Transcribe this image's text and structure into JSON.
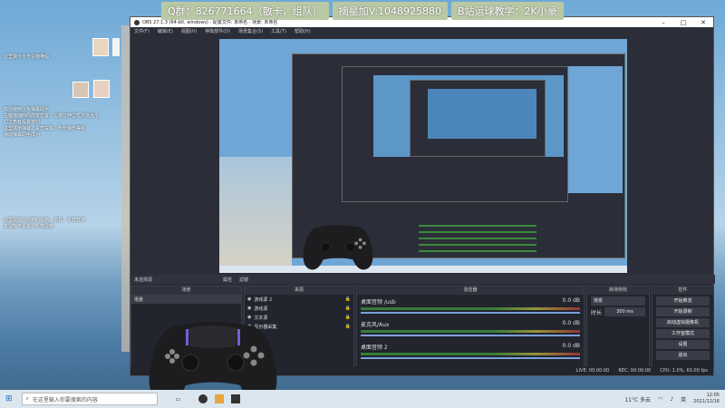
{
  "banner": {
    "qq": "Q群：826771664（散卡，组队）",
    "wechat": "摘星加V:1048925880",
    "bilibili": "B站运球教学：2K小豪"
  },
  "desktop": {
    "note1": "这里展示大吉造物横幅",
    "note2": "欢迎使用斗鱼弹幕助手\n左键拖拽四周改变位置，左键拉伸边框改变大小\n右上角有设置按钮\n这里展示弹幕、贵宾提醒、粉丝弹升等级\n滑动弹幕助手成功",
    "note3": "这里展示你收到的礼物、道具、贵宾开通\n进鼠标可设置小礼物屏蔽"
  },
  "obs": {
    "title": "OBS 27.1.3 (64-bit, windows) - 配置文件: 未命名 - 场景: 未命名",
    "menus": [
      "文件(F)",
      "编辑(E)",
      "视图(V)",
      "停靠部件(D)",
      "场景集合(S)",
      "工具(T)",
      "帮助(H)"
    ],
    "scene_transition_label": "未选择源",
    "properties_btn": "属性",
    "filters_btn": "滤镜",
    "docks": {
      "scenes": "场景",
      "sources": "来源",
      "mixer": "混音器",
      "transitions": "转场特效",
      "controls": "控件"
    },
    "scene_item": "场景",
    "sources": [
      "游戏源 2",
      "游戏源",
      "文本源",
      "显示器采集"
    ],
    "mixer": [
      {
        "name": "桌面音频 /usb",
        "db": "0.0 dB"
      },
      {
        "name": "麦克风/Aux",
        "db": "0.0 dB"
      },
      {
        "name": "桌面音频 2",
        "db": "0.0 dB"
      }
    ],
    "transition": {
      "type": "渐变",
      "duration_label": "时长",
      "duration": "300 ms"
    },
    "controls": [
      "开始推流",
      "开始录制",
      "启动虚拟摄像机",
      "工作室模式",
      "设置",
      "退出"
    ],
    "status": {
      "live": "LIVE: 00:00:00",
      "rec": "REC: 00:00:00",
      "cpu": "CPU: 1.0%, 60.00 fps"
    }
  },
  "taskbar": {
    "search_placeholder": "在这里输入你要搜索的内容",
    "weather": "11°C 多云",
    "ime": "英",
    "time": "12:05",
    "date": "2021/12/16"
  },
  "colors": {
    "obs_bg": "#2b2e38",
    "banner_bg": "#b9c9a5",
    "sky": "#6fa9d6"
  },
  "icons": [
    "windows-start-icon",
    "search-icon",
    "task-view-icon",
    "obs-icon",
    "folder-icon",
    "gamepad-icon",
    "wifi-icon",
    "speaker-icon"
  ]
}
